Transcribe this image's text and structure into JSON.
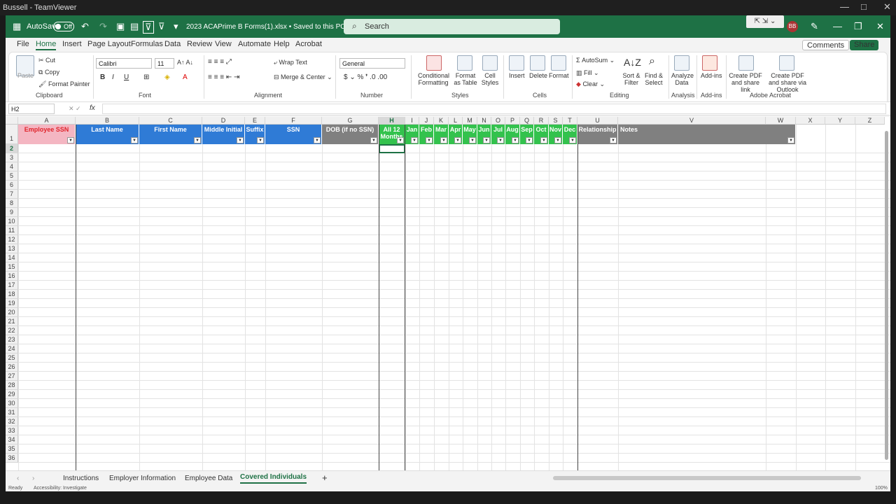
{
  "window": {
    "title": "Bussell - TeamViewer",
    "minimize": "—",
    "maximize": "□",
    "close": "✕"
  },
  "excel": {
    "autosave_label": "AutoSave",
    "autosave_state": "Off",
    "filename": "2023 ACAPrime B Forms(1).xlsx  •  Saved to this PC ⌄",
    "search_placeholder": "Search",
    "avatar": "BB",
    "tv_controls": "⇱ ⇲ ⌄"
  },
  "menu": {
    "file": "File",
    "home": "Home",
    "insert": "Insert",
    "page_layout": "Page Layout",
    "formulas": "Formulas",
    "data": "Data",
    "review": "Review",
    "view": "View",
    "automate": "Automate",
    "help": "Help",
    "acrobat": "Acrobat",
    "comments": "Comments",
    "share": "Share"
  },
  "ribbon": {
    "paste": "Paste",
    "cut": "Cut",
    "copy": "Copy",
    "format_painter": "Format Painter",
    "clipboard": "Clipboard",
    "font_name": "Calibri",
    "font_size": "11",
    "font": "Font",
    "wrap_text": "Wrap Text",
    "merge_center": "Merge & Center",
    "alignment": "Alignment",
    "number_format": "General",
    "number": "Number",
    "cond_format": "Conditional Formatting",
    "format_table": "Format as Table",
    "cell_styles": "Cell Styles",
    "styles": "Styles",
    "insert": "Insert",
    "delete": "Delete",
    "format": "Format",
    "cells": "Cells",
    "autosum": "AutoSum",
    "fill": "Fill",
    "clear": "Clear",
    "sort_filter": "Sort & Filter",
    "find_select": "Find & Select",
    "editing": "Editing",
    "analyze": "Analyze Data",
    "analysis": "Analysis",
    "addins": "Add-ins",
    "addins_group": "Add-ins",
    "pdf_share": "Create PDF and share link",
    "pdf_outlook": "Create PDF and share via Outlook",
    "acrobat_group": "Adobe Acrobat"
  },
  "formula_bar": {
    "name_box": "H2",
    "fx": "fx",
    "value": ""
  },
  "columns": [
    "A",
    "B",
    "C",
    "D",
    "E",
    "F",
    "G",
    "H",
    "I",
    "J",
    "K",
    "L",
    "M",
    "N",
    "O",
    "P",
    "Q",
    "R",
    "S",
    "T",
    "U",
    "V",
    "W",
    "X",
    "Y",
    "Z"
  ],
  "headers": [
    "Employee SSN",
    "Last Name",
    "First Name",
    "Middle Initial",
    "Suffix",
    "SSN",
    "DOB (if no SSN)",
    "All 12 Months",
    "Jan",
    "Feb",
    "Mar",
    "Apr",
    "May",
    "Jun",
    "Jul",
    "Aug",
    "Sep",
    "Oct",
    "Nov",
    "Dec",
    "Relationship",
    "Notes"
  ],
  "header_colors": {
    "pink": "#f4b6c2",
    "blue": "#2f7bd6",
    "gray": "#808080",
    "green": "#33c24d",
    "red_text": "#e0242b"
  },
  "rows": [
    "1",
    "2",
    "3",
    "4",
    "5",
    "6",
    "7",
    "8",
    "9",
    "10",
    "11",
    "12",
    "13",
    "14",
    "15",
    "16",
    "17",
    "18",
    "19",
    "20",
    "21",
    "22",
    "23",
    "24",
    "25",
    "26",
    "27",
    "28",
    "29",
    "30",
    "31",
    "32",
    "33",
    "34",
    "35",
    "36"
  ],
  "sheets": {
    "tabs": [
      "Instructions",
      "Employer Information",
      "Employee Data",
      "Covered Individuals"
    ],
    "active": "Covered Individuals",
    "add": "+"
  },
  "status": {
    "ready": "Ready",
    "accessibility": "Accessibility: Investigate",
    "zoom": "100%"
  }
}
